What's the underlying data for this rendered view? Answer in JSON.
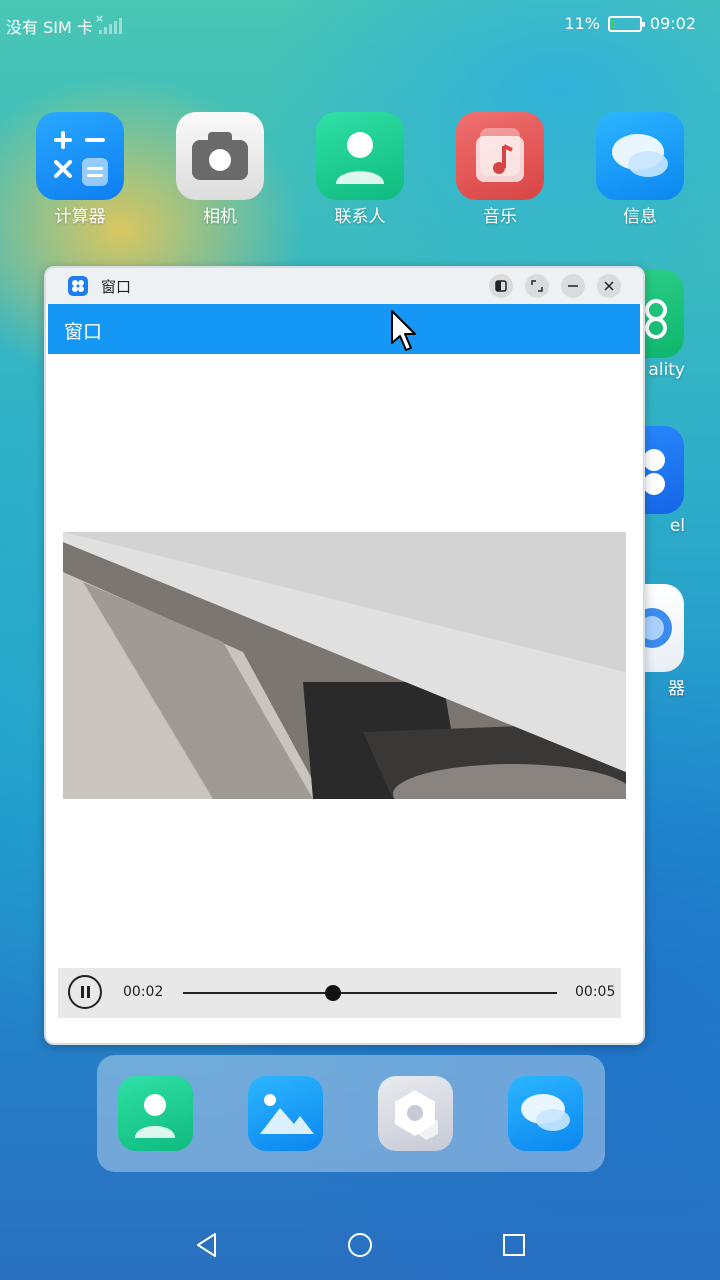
{
  "status_bar": {
    "carrier": "没有 SIM 卡",
    "signal_x": "×",
    "battery_percent": "11%",
    "battery_level": 0.11,
    "time": "09:02"
  },
  "home": {
    "apps": [
      {
        "label": "计算器",
        "icon": "calculator-icon"
      },
      {
        "label": "相机",
        "icon": "camera-icon"
      },
      {
        "label": "联系人",
        "icon": "contacts-icon"
      },
      {
        "label": "音乐",
        "icon": "music-icon"
      },
      {
        "label": "信息",
        "icon": "messages-icon"
      }
    ],
    "partial_labels": [
      "ality",
      "el",
      "器"
    ]
  },
  "window": {
    "title": "窗口",
    "appbar_title": "窗口",
    "buttons": [
      "split-icon",
      "maximize-icon",
      "minimize-icon",
      "close-icon"
    ]
  },
  "player": {
    "current_time": "00:02",
    "total_time": "00:05",
    "progress": 0.4
  },
  "dock": {
    "apps": [
      "contacts-icon",
      "gallery-icon",
      "settings-icon",
      "messages-icon"
    ]
  },
  "navbar": {
    "buttons": [
      "back-icon",
      "home-icon",
      "recents-icon"
    ]
  }
}
